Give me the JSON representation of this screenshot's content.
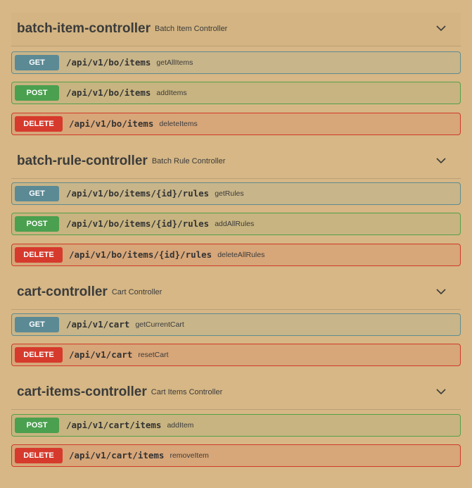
{
  "sections": [
    {
      "name": "batch-item-controller",
      "description": "Batch Item Controller",
      "operations": [
        {
          "method": "GET",
          "path": "/api/v1/bo/items",
          "operation_id": "getAllItems"
        },
        {
          "method": "POST",
          "path": "/api/v1/bo/items",
          "operation_id": "addItems"
        },
        {
          "method": "DELETE",
          "path": "/api/v1/bo/items",
          "operation_id": "deleteItems"
        }
      ]
    },
    {
      "name": "batch-rule-controller",
      "description": "Batch Rule Controller",
      "operations": [
        {
          "method": "GET",
          "path": "/api/v1/bo/items/{id}/rules",
          "operation_id": "getRules"
        },
        {
          "method": "POST",
          "path": "/api/v1/bo/items/{id}/rules",
          "operation_id": "addAllRules"
        },
        {
          "method": "DELETE",
          "path": "/api/v1/bo/items/{id}/rules",
          "operation_id": "deleteAllRules"
        }
      ]
    },
    {
      "name": "cart-controller",
      "description": "Cart Controller",
      "operations": [
        {
          "method": "GET",
          "path": "/api/v1/cart",
          "operation_id": "getCurrentCart"
        },
        {
          "method": "DELETE",
          "path": "/api/v1/cart",
          "operation_id": "resetCart"
        }
      ]
    },
    {
      "name": "cart-items-controller",
      "description": "Cart Items Controller",
      "operations": [
        {
          "method": "POST",
          "path": "/api/v1/cart/items",
          "operation_id": "addItem"
        },
        {
          "method": "DELETE",
          "path": "/api/v1/cart/items",
          "operation_id": "removeItem"
        }
      ]
    }
  ],
  "icons": {
    "section_toggle": "chevron-down-icon"
  },
  "colors": {
    "background": "#d6b785",
    "get": "#5b8a95",
    "post": "#4aa04f",
    "delete": "#d63a2c"
  }
}
